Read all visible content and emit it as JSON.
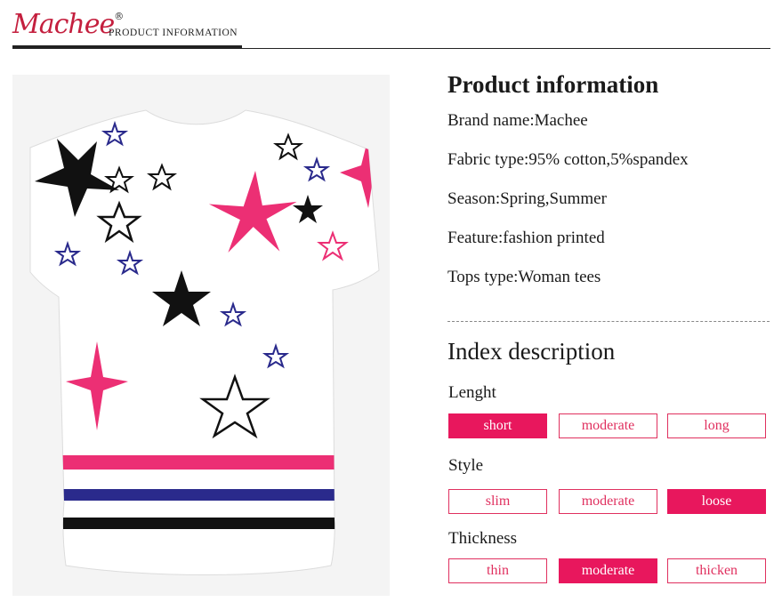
{
  "header": {
    "logo_text": "Machee",
    "logo_mark": "®",
    "title": "PRODUCT INFORMATION"
  },
  "colors": {
    "accent": "#e8175d",
    "pink": "#ec2f74",
    "navy": "#2a2a8c",
    "black": "#111111"
  },
  "product_info": {
    "title": "Product information",
    "rows": [
      "Brand name:Machee",
      "Fabric type:95% cotton,5%spandex",
      "Season:Spring,Summer",
      "Feature:fashion printed",
      "Tops type:Woman tees"
    ]
  },
  "index_description": {
    "title": "Index description",
    "groups": [
      {
        "label": "Lenght",
        "options": [
          "short",
          "moderate",
          "long"
        ],
        "selected": "short"
      },
      {
        "label": "Style",
        "options": [
          "slim",
          "moderate",
          "loose"
        ],
        "selected": "loose"
      },
      {
        "label": "Thickness",
        "options": [
          "thin",
          "moderate",
          "thicken"
        ],
        "selected": "moderate"
      }
    ]
  }
}
